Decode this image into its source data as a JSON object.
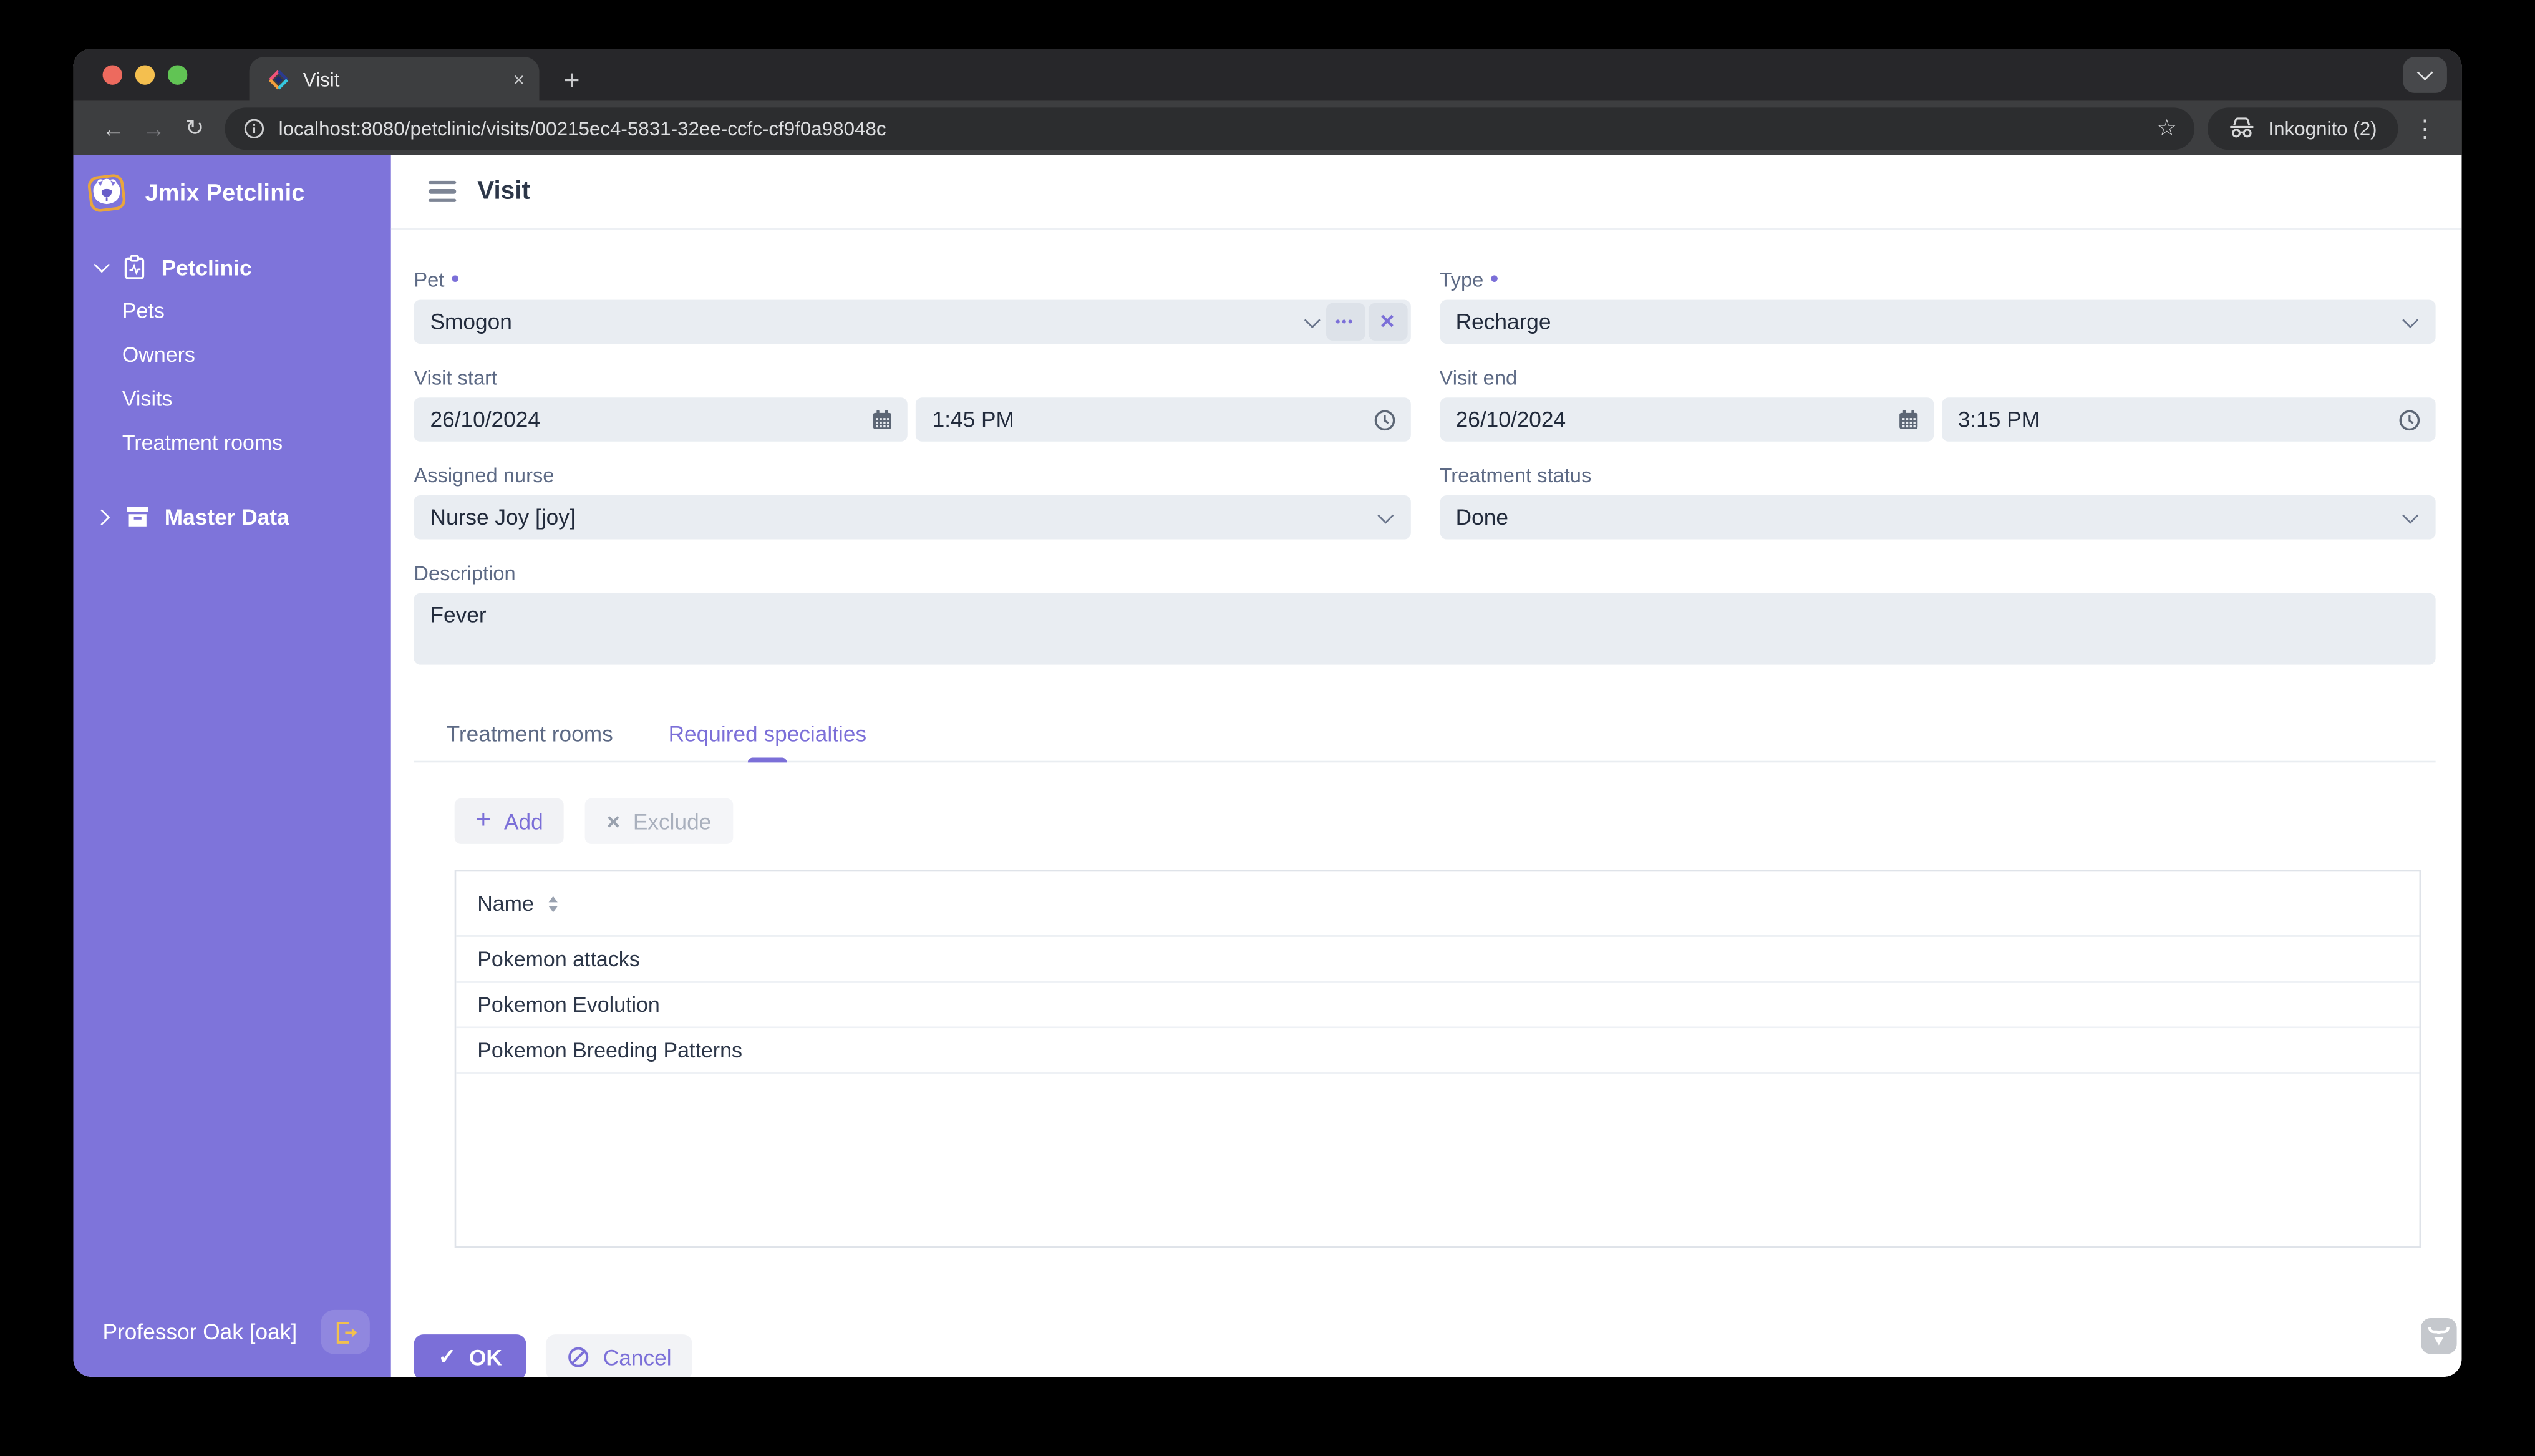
{
  "browser": {
    "tab_title": "Visit",
    "url": "localhost:8080/petclinic/visits/00215ec4-5831-32ee-ccfc-cf9f0a98048c",
    "incognito_label": "Inkognito (2)"
  },
  "glyphs": {
    "plus": "+",
    "close": "×",
    "back": "←",
    "forward": "→",
    "reload": "↻",
    "star": "☆",
    "menu": "⋮",
    "check": "✓",
    "x": "×",
    "ellipsis": "•••",
    "required": "•"
  },
  "sidebar": {
    "app_title": "Jmix Petclinic",
    "petclinic_section": "Petclinic",
    "items": [
      {
        "label": "Pets"
      },
      {
        "label": "Owners"
      },
      {
        "label": "Visits"
      },
      {
        "label": "Treatment rooms"
      }
    ],
    "master_data_section": "Master Data",
    "user_label": "Professor Oak [oak]"
  },
  "page": {
    "title": "Visit",
    "fields": {
      "pet_label": "Pet",
      "pet_value": "Smogon",
      "type_label": "Type",
      "type_value": "Recharge",
      "visit_start_label": "Visit start",
      "visit_start_date": "26/10/2024",
      "visit_start_time": "1:45 PM",
      "visit_end_label": "Visit end",
      "visit_end_date": "26/10/2024",
      "visit_end_time": "3:15 PM",
      "assigned_nurse_label": "Assigned nurse",
      "assigned_nurse_value": "Nurse Joy [joy]",
      "treatment_status_label": "Treatment status",
      "treatment_status_value": "Done",
      "description_label": "Description",
      "description_value": "Fever"
    },
    "tabs": [
      {
        "label": "Treatment rooms"
      },
      {
        "label": "Required specialties"
      }
    ],
    "buttons": {
      "add": "Add",
      "exclude": "Exclude",
      "ok": "OK",
      "cancel": "Cancel"
    },
    "table": {
      "columns": [
        "Name"
      ],
      "rows": [
        {
          "name": "Pokemon attacks"
        },
        {
          "name": "Pokemon Evolution"
        },
        {
          "name": "Pokemon Breeding Patterns"
        }
      ]
    }
  },
  "colors": {
    "accent": "#7b6fd8",
    "sidebar_bg": "#7e74da",
    "field_bg": "#e9edf2",
    "logout_icon": "#f2c14e"
  }
}
